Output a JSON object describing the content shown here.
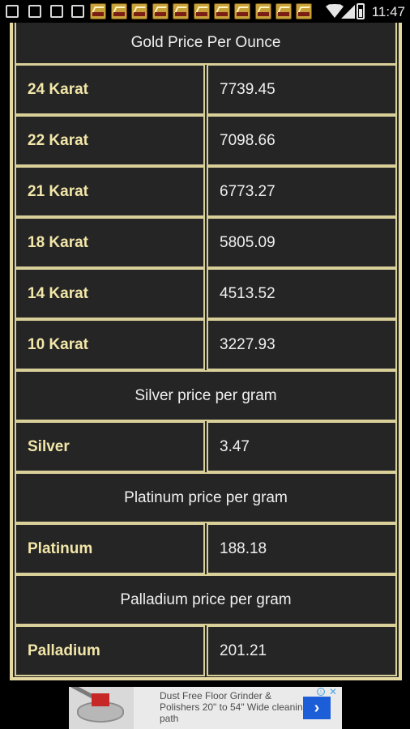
{
  "status_bar": {
    "time": "11:47",
    "icons": [
      "back-arrow-icon",
      "facebook-icon",
      "tools-icon",
      "image-icon",
      "app-notification-icon",
      "app-notification-icon",
      "app-notification-icon",
      "app-notification-icon",
      "app-notification-icon",
      "app-notification-icon",
      "app-notification-icon",
      "app-notification-icon",
      "app-notification-icon",
      "app-notification-icon",
      "app-notification-icon",
      "wifi-icon",
      "signal-icon",
      "battery-icon"
    ]
  },
  "rates": {
    "gold_header": "Gold Price Per Ounce",
    "gold_rows": [
      {
        "label": "24 Karat",
        "value": "7739.45"
      },
      {
        "label": "22 Karat",
        "value": "7098.66"
      },
      {
        "label": "21 Karat",
        "value": "6773.27"
      },
      {
        "label": "18 Karat",
        "value": "5805.09"
      },
      {
        "label": "14 Karat",
        "value": "4513.52"
      },
      {
        "label": "10 Karat",
        "value": "3227.93"
      }
    ],
    "silver_header": "Silver price per gram",
    "silver": {
      "label": "Silver",
      "value": "3.47"
    },
    "platinum_header": "Platinum price per gram",
    "platinum": {
      "label": "Platinum",
      "value": "188.18"
    },
    "palladium_header": "Palladium price per gram",
    "palladium": {
      "label": "Palladium",
      "value": "201.21"
    }
  },
  "ad": {
    "text": "Dust Free Floor Grinder & Polishers 20\" to 54\" Wide cleaning path",
    "arrow": "›",
    "info_icon": "ⓘ",
    "close_icon": "✕"
  },
  "colors": {
    "accent": "#e3d9a1",
    "label_text": "#f2e6a8",
    "background": "#252525"
  }
}
